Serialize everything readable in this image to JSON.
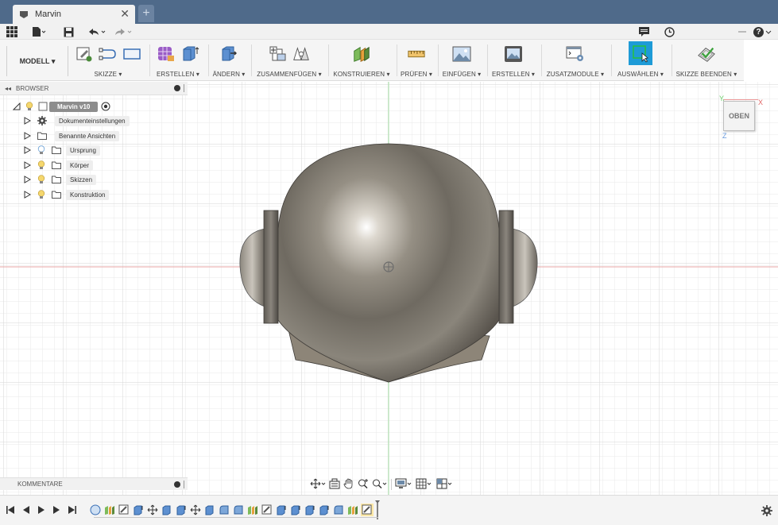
{
  "document": {
    "tab_title": "Marvin",
    "close_glyph": "✕",
    "new_tab_glyph": "+"
  },
  "qat": {
    "help_label": "?"
  },
  "ribbon": {
    "workspace_label": "MODELL ▾",
    "groups": [
      {
        "label": "SKIZZE ▾"
      },
      {
        "label": "ERSTELLEN ▾"
      },
      {
        "label": "ÄNDERN ▾"
      },
      {
        "label": "ZUSAMMENFÜGEN ▾"
      },
      {
        "label": "KONSTRUIEREN ▾"
      },
      {
        "label": "PRÜFEN ▾"
      },
      {
        "label": "EINFÜGEN ▾"
      },
      {
        "label": "ERSTELLEN ▾"
      },
      {
        "label": "ZUSATZMODULE ▾"
      },
      {
        "label": "AUSWÄHLEN ▾"
      },
      {
        "label": "SKIZZE BEENDEN ▾"
      }
    ]
  },
  "browser": {
    "title": "BROWSER",
    "root": "Marvin v10",
    "items": [
      {
        "label": "Dokumenteinstellungen",
        "icon": "gear-icon"
      },
      {
        "label": "Benannte Ansichten",
        "icon": "folder-icon"
      },
      {
        "label": "Ursprung",
        "icon": "folder-icon"
      },
      {
        "label": "Körper",
        "icon": "folder-icon"
      },
      {
        "label": "Skizzen",
        "icon": "folder-icon"
      },
      {
        "label": "Konstruktion",
        "icon": "folder-icon"
      }
    ]
  },
  "comments": {
    "title": "KOMMENTARE"
  },
  "viewcube": {
    "face_label": "OBEN",
    "axis_x": "X",
    "axis_y": "Y",
    "axis_z": "Z"
  },
  "colors": {
    "accent_select": "#1e9bd7",
    "titlebar": "#4f6a8a"
  }
}
